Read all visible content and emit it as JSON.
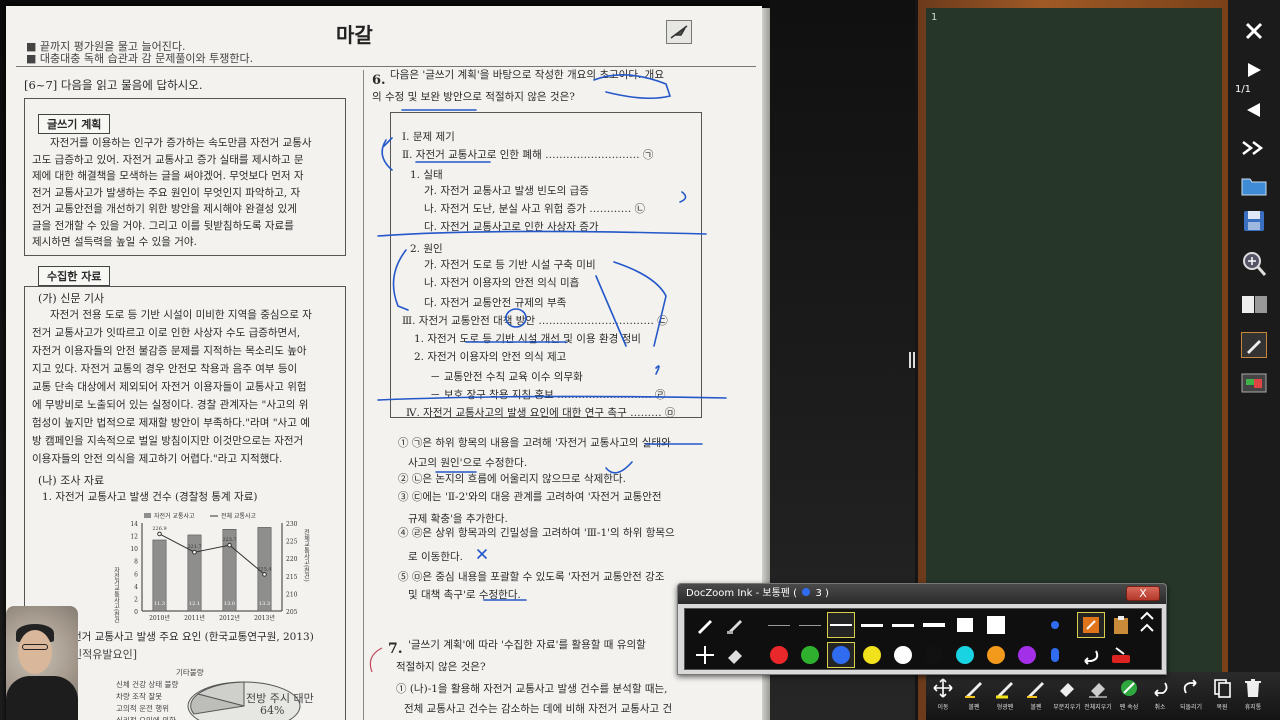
{
  "document": {
    "header_line1": "■ 끝까지 평가원을 물고 늘어진다.",
    "header_line2": "■ 대충대충 독해 습관과 감 문제풀이와 투쟁한다.",
    "handwritten_title": "마갈",
    "left": {
      "question_range": "[6~7] 다음을 읽고 물음에 답하시오.",
      "writing_plan_label": "글쓰기 계획",
      "writing_plan_lines": [
        "자전거를 이용하는 인구가 증가하는 속도만큼 자전거 교통사",
        "고도 급증하고 있어. 자전거 교통사고 증가 실태를 제시하고 문",
        "제에 대한 해결책을 모색하는 글을 써야겠어. 무엇보다 먼저 자",
        "전거 교통사고가 발생하는 주요 원인이 무엇인지 파악하고, 자",
        "전거 교통안전을 개선하기 위한 방안을 제시해야 완결성 있게",
        "글을 전개할 수 있을 거야. 그리고 이를 뒷받침하도록 자료를",
        "제시하면 설득력을 높일 수 있을 거야."
      ],
      "collected_label": "수집한 자료",
      "news_heading": "(가) 신문 기사",
      "news_lines": [
        "자전거 전용 도로 등 기반 시설이 미비한 지역을 중심으로 자",
        "전거 교통사고가 잇따르고 이로 인한 사상자 수도 급증하면서,",
        "자전거 이용자들의 안전 불감증 문제를 지적하는 목소리도 높아",
        "지고 있다. 자전거 교통의 경우 안전모 착용과 음주 여부 등이",
        "교통 단속 대상에서 제외되어 자전거 이용자들이 교통사고 위험",
        "에 무방비로 노출되어 있는 실정이다. 경찰 관계자는 \"사고의 위",
        "험성이 높지만 법적으로 제재할 방안이 부족하다.\"라며 \"사고 예",
        "방 캠페인을 지속적으로 벌일 방침이지만 이것만으로는 자전거",
        "이용자들의 안전 의식을 제고하기 어렵다.\"라고 지적했다."
      ],
      "survey_heading": "(나) 조사 자료",
      "survey_item1": "1. 자전거 교통사고 발생 건수 (경찰청 통계 자료)",
      "survey_item2_partial": "전거 교통사고 발생 주요 요인 (한국교통연구원, 2013)",
      "survey_item2_sub": "인적유발요인]",
      "pie_labels": [
        "기타불량",
        "신체 건강 상태 불량",
        "차량 조작 잘못",
        "고의적 운전 행위",
        "심리적 요인에 의한"
      ],
      "pie_value_label": "전방 주시 태만",
      "pie_value": "64%"
    },
    "right": {
      "q6_number": "6.",
      "q6_text_1": "다음은 '글쓰기 계획'을 바탕으로 작성한 개요의 초고이다. 개요",
      "q6_text_2": "의 수정 및 보완 방안으로 적절하지 않은 것은?",
      "outline": [
        "Ⅰ. 문제 제기",
        "Ⅱ. 자전거 교통사고로 인한 폐해 ……………………… ㉠",
        "1. 실태",
        "가. 자전거 교통사고 발생 빈도의 급증",
        "나. 자전거 도난, 분실 사고 위험 증가 ………… ㉡",
        "다. 자전거 교통사고로 인한 사상자 증가",
        "2. 원인",
        "가. 자전거 도로 등 기반 시설 구축 미비",
        "나. 자전거 이용자의 안전 의식 미흡",
        "다. 자전거 교통안전 규제의 부족",
        "Ⅲ. 자전거 교통안전 대책 방안 …………………………… ㉢",
        "1. 자전거 도로 등 기반 시설 개선 및 이용 환경 정비",
        "2. 자전거 이용자의 안전 의식 제고",
        "－ 교통안전 수칙 교육 이수 의무화",
        "－ 보호 장구 착용 지침 홍보 ……………………… ㉣",
        "Ⅳ. 자전거 교통사고의 발생 요인에 대한 연구 촉구 ……… ㉤"
      ],
      "options": [
        "① ㉠은 하위 항목의 내용을 고려해 '자전거 교통사고의 실태와",
        "사고의 원인'으로 수정한다.",
        "② ㉡은 논지의 흐름에 어울리지 않으므로 삭제한다.",
        "③ ㉢에는 'Ⅱ-2'와의 대응 관계를 고려하여 '자전거 교통안전",
        "규제 확충'을 추가한다.",
        "④ ㉣은 상위 항목과의 긴밀성을 고려하여 'Ⅲ-1'의 하위 항목으",
        "로 이동한다.",
        "⑤ ㉤은 중심 내용을 포괄할 수 있도록 '자전거 교통안전 강조",
        "및 대책 촉구'로 수정한다."
      ],
      "q7_number": "7.",
      "q7_text_1": "'글쓰기 계획'에 따라 '수집한 자료'를 활용할 때 유의할",
      "q7_text_2": "적절하지 않은 것은?",
      "q7_opt1_1": "① (나)-1을 활용해 자전거 교통사고 발생 건수를 분석할 때는,",
      "q7_opt1_2": "전체 교통사고 건수는 감소하는 데에 비해 자전거 교통사고 건"
    }
  },
  "chart_data": {
    "type": "bar",
    "title": "",
    "legend": [
      "자전거 교통사고",
      "전체 교통사고"
    ],
    "categories": [
      "2010년",
      "2011년",
      "2012년",
      "2013년"
    ],
    "series": [
      {
        "name": "자전거 교통사고",
        "values": [
          11.3,
          12.1,
          13.0,
          13.3
        ],
        "labels": [
          "11.3",
          "12.1",
          "13.0",
          "13.3"
        ]
      },
      {
        "name": "전체 교통사고",
        "values": [
          226.9,
          221.7,
          223.7,
          215.4
        ],
        "labels": [
          "226.9",
          "221.7",
          "223.7",
          "215.4"
        ]
      }
    ],
    "y_left_label": "자전거교통사고(천건)",
    "y_left_ticks": [
      "0",
      "2",
      "4",
      "6",
      "8",
      "10",
      "12",
      "14"
    ],
    "y_right_label": "전체교통사고(천건)",
    "y_right_ticks": [
      "205",
      "210",
      "215",
      "220",
      "225",
      "230"
    ],
    "y_right_lim": [
      205,
      230
    ],
    "y_left_lim": [
      0,
      14
    ]
  },
  "board": {
    "page_number": "1"
  },
  "right_toolbar": {
    "page_indicator": "1/1"
  },
  "bottom_toolbar": [
    {
      "label": "이동",
      "icon": "move-icon"
    },
    {
      "label": "볼펜",
      "icon": "pen-icon"
    },
    {
      "label": "형광펜",
      "icon": "highlighter-icon"
    },
    {
      "label": "볼펜",
      "icon": "pen-icon"
    },
    {
      "label": "부분지우기",
      "icon": "eraser-icon"
    },
    {
      "label": "전체지우기",
      "icon": "eraser-all-icon"
    },
    {
      "label": "펜 속성",
      "icon": "pen-settings-icon"
    },
    {
      "label": "취소",
      "icon": "undo-icon"
    },
    {
      "label": "되돌리기",
      "icon": "redo-icon"
    },
    {
      "label": "복원",
      "icon": "copy-icon"
    },
    {
      "label": "휴지통",
      "icon": "trash-icon"
    }
  ],
  "ink_palette": {
    "title": "DocZoom Ink - 보통펜 (",
    "title_count": "3",
    "title_suffix": ")",
    "close_label": "X",
    "colors": [
      "#e8282b",
      "#2fb12f",
      "#2f6cf0",
      "#f2e21b",
      "#ffffff",
      "#111111",
      "#19d3e3",
      "#f3991b",
      "#a32fe8"
    ]
  }
}
